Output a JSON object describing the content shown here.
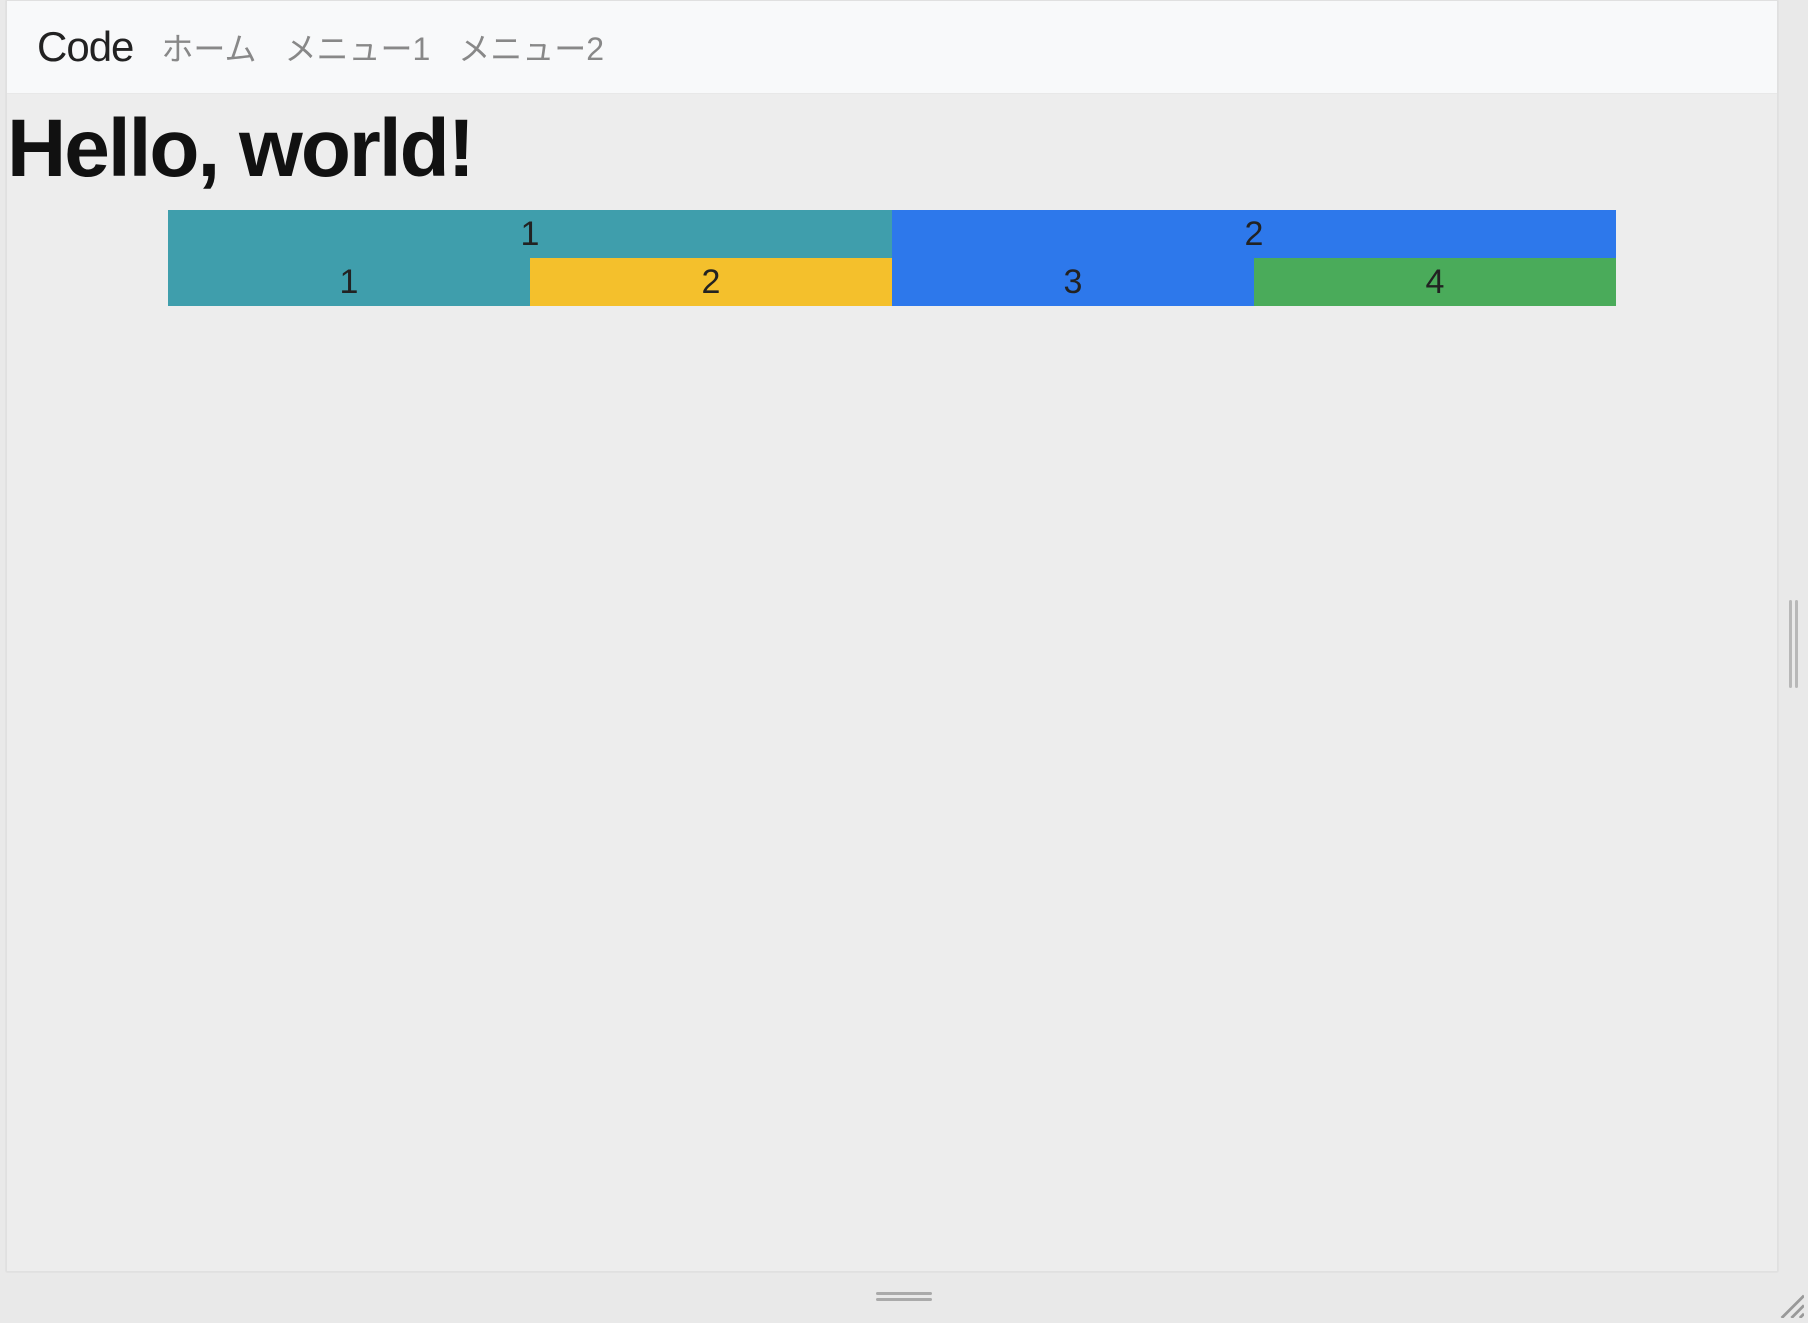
{
  "navbar": {
    "brand": "Code",
    "links": [
      "ホーム",
      "メニュー1",
      "メニュー2"
    ]
  },
  "heading": "Hello, world!",
  "grid": {
    "row1": [
      "1",
      "2"
    ],
    "row2": [
      "1",
      "2",
      "3",
      "4"
    ]
  },
  "colors": {
    "teal": "#3f9eac",
    "blue": "#2d78eb",
    "orange": "#f4c02c",
    "green": "#4aab5a"
  }
}
